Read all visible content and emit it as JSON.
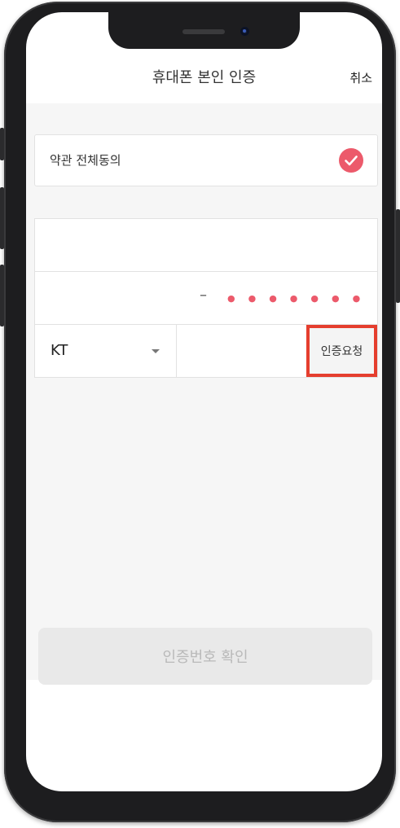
{
  "header": {
    "title": "휴대폰 본인 인증",
    "cancel_label": "취소"
  },
  "agreement": {
    "label": "약관 전체동의",
    "checked": true
  },
  "form": {
    "name_value": "",
    "resident_number_masked": "●●●●●●●",
    "resident_number_dash": "–",
    "carrier_selected": "KT",
    "phone_value": "",
    "request_button_label": "인증요청"
  },
  "confirm_button_label": "인증번호 확인",
  "colors": {
    "accent": "#ec5a6b",
    "highlight_border": "#e53e2e",
    "content_bg": "#f6f6f6",
    "disabled_button_bg": "#e9e9e9",
    "disabled_button_text": "#b9b9b9"
  },
  "icons": {
    "agreement_check": "check-circle-icon",
    "carrier_dropdown": "caret-down-icon"
  }
}
